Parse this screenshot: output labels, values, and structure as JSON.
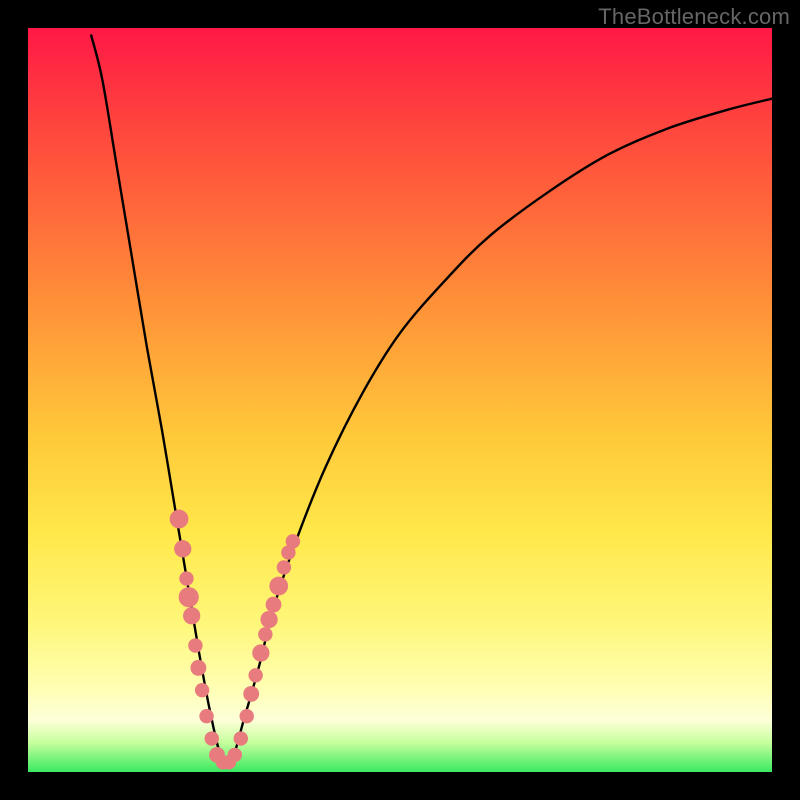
{
  "watermark": "TheBottleneck.com",
  "colors": {
    "page_bg": "#000000",
    "curve_stroke": "#000000",
    "marker_fill": "#e77b7e",
    "marker_stroke": "#cf5f62",
    "gradient_top": "#ff1846",
    "gradient_mid": "#ffe84a",
    "gradient_bottom": "#39e961"
  },
  "chart_data": {
    "type": "line",
    "title": "",
    "xlabel": "",
    "ylabel": "",
    "xlim": [
      0,
      100
    ],
    "ylim": [
      0,
      100
    ],
    "grid": false,
    "legend": false,
    "note": "V-shaped bottleneck curve; x and y are relative percentages of the plot area (0=left/bottom, 100=right/top). Curve descends steeply from near top-left, reaches ~0 around x≈26, then rises with decreasing slope toward upper-right.",
    "series": [
      {
        "name": "bottleneck-curve",
        "x": [
          8.5,
          10,
          12,
          14,
          16,
          18,
          20,
          21.5,
          23,
          24.5,
          26,
          27.5,
          29,
          31,
          33,
          36,
          40,
          45,
          50,
          56,
          62,
          70,
          78,
          86,
          94,
          100
        ],
        "y": [
          99,
          93,
          81,
          69,
          57,
          46,
          34,
          25,
          16,
          8,
          2,
          2,
          7,
          14,
          22,
          31,
          41,
          51,
          59,
          66,
          72,
          78,
          83,
          86.5,
          89,
          90.5
        ]
      }
    ],
    "markers": {
      "name": "highlight-dots",
      "note": "Salmon/pink dots clustered near the valley on both branches of the V.",
      "points": [
        {
          "x": 20.3,
          "y": 34,
          "r": 1.3
        },
        {
          "x": 20.8,
          "y": 30,
          "r": 1.2
        },
        {
          "x": 21.3,
          "y": 26,
          "r": 1.0
        },
        {
          "x": 21.6,
          "y": 23.5,
          "r": 1.4
        },
        {
          "x": 22.0,
          "y": 21,
          "r": 1.2
        },
        {
          "x": 22.5,
          "y": 17,
          "r": 1.0
        },
        {
          "x": 22.9,
          "y": 14,
          "r": 1.1
        },
        {
          "x": 23.4,
          "y": 11,
          "r": 1.0
        },
        {
          "x": 24.0,
          "y": 7.5,
          "r": 1.0
        },
        {
          "x": 24.7,
          "y": 4.5,
          "r": 1.0
        },
        {
          "x": 25.4,
          "y": 2.3,
          "r": 1.1
        },
        {
          "x": 26.2,
          "y": 1.3,
          "r": 1.0
        },
        {
          "x": 27.0,
          "y": 1.3,
          "r": 1.0
        },
        {
          "x": 27.8,
          "y": 2.3,
          "r": 1.0
        },
        {
          "x": 28.6,
          "y": 4.5,
          "r": 1.0
        },
        {
          "x": 29.4,
          "y": 7.5,
          "r": 1.0
        },
        {
          "x": 30.0,
          "y": 10.5,
          "r": 1.1
        },
        {
          "x": 30.6,
          "y": 13,
          "r": 1.0
        },
        {
          "x": 31.3,
          "y": 16,
          "r": 1.2
        },
        {
          "x": 31.9,
          "y": 18.5,
          "r": 1.0
        },
        {
          "x": 32.4,
          "y": 20.5,
          "r": 1.2
        },
        {
          "x": 33.0,
          "y": 22.5,
          "r": 1.1
        },
        {
          "x": 33.7,
          "y": 25,
          "r": 1.3
        },
        {
          "x": 34.4,
          "y": 27.5,
          "r": 1.0
        },
        {
          "x": 35.0,
          "y": 29.5,
          "r": 1.0
        },
        {
          "x": 35.6,
          "y": 31,
          "r": 1.0
        }
      ]
    }
  }
}
